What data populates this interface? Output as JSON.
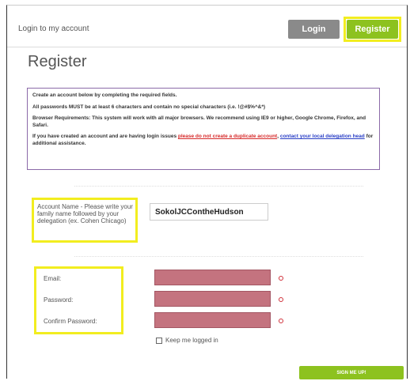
{
  "header": {
    "login_link": "Login to my account",
    "login_button": "Login",
    "register_button": "Register"
  },
  "page": {
    "title": "Register"
  },
  "info": {
    "line1": "Create an account below by completing the required fields.",
    "line2": "All passwords MUST be at least 6 characters and contain no special characters (i.e. !@#$%^&*)",
    "line3": "Browser Requirements: This system will work with all major browsers. We recommend using IE9 or higher, Google Chrome, Firefox, and Safari.",
    "line4_prefix": "If you have created an account and are having login issues ",
    "line4_link_red": "please do not create a duplicate account",
    "line4_mid": ", ",
    "line4_link_blue": "contact your local delegation head",
    "line4_suffix": " for additional assistance."
  },
  "account": {
    "label": "Account Name - Please write your family name followed by your delegation (ex. Cohen Chicago)",
    "value": "SokolJCContheHudson"
  },
  "fields": {
    "email_label": "Email:",
    "password_label": "Password:",
    "confirm_label": "Confirm Password:"
  },
  "remember": {
    "label": "Keep me logged in"
  },
  "signup": {
    "label": "SIGN ME UP!"
  },
  "colors": {
    "accent_green": "#8dc21f",
    "highlight_yellow": "#f2ed1f",
    "error_field": "#c4737f"
  }
}
